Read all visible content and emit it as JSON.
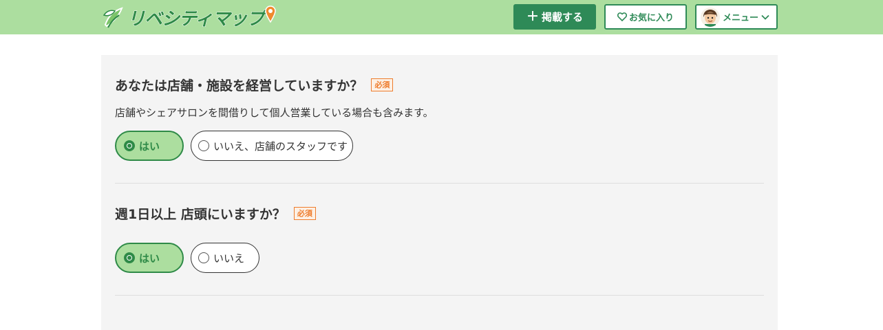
{
  "header": {
    "logo_text": "リベシティマップ",
    "post_button": "掲載する",
    "favorites_button": "お気に入り",
    "menu_button": "メニュー"
  },
  "colors": {
    "header_bg": "#acde9f",
    "accent": "#2e8a57",
    "required": "#ee7c2c",
    "card_bg": "#f4f4f4"
  },
  "questions": [
    {
      "title": "あなたは店舗・施設を経営していますか？",
      "required_label": "必須",
      "description": "店舗やシェアサロンを間借りして個人営業している場合も含みます。",
      "options": [
        {
          "label": "はい",
          "selected": true
        },
        {
          "label": "いいえ、店舗のスタッフです",
          "selected": false
        }
      ]
    },
    {
      "title": "週1日以上 店頭にいますか？",
      "required_label": "必須",
      "options": [
        {
          "label": "はい",
          "selected": true
        },
        {
          "label": "いいえ",
          "selected": false
        }
      ]
    }
  ]
}
